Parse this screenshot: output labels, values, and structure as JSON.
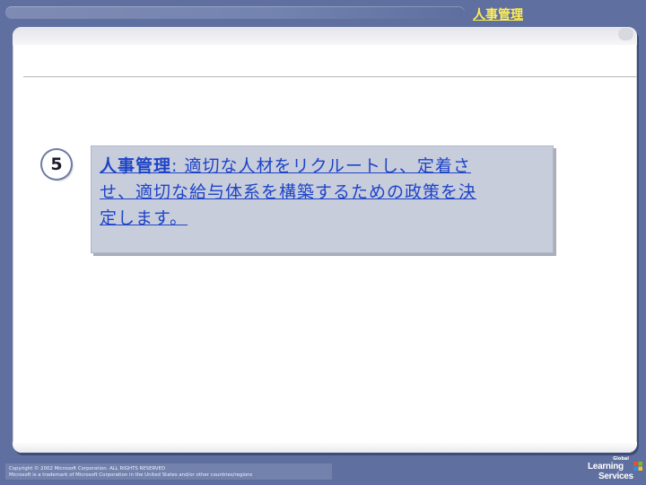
{
  "header": {
    "topic_link": "人事管理"
  },
  "slide": {
    "number": "5",
    "term": "人事管理",
    "separator": ":",
    "definition_line1": " 適切な人材をリクルートし、定着さ",
    "definition_line2": "せ、適切な給与体系を構築するための政策を決",
    "definition_line3": "定します。"
  },
  "footer": {
    "copyright_line1": "Copyright © 2002 Microsoft Corporation. ALL RIGHTS RESERVED",
    "copyright_line2": "Microsoft is a trademark of Microsoft Corporation in the United States and/or other countries/regions",
    "logo_top": "Global",
    "logo_learning": "Learning",
    "logo_services": "Services"
  },
  "colors": {
    "background": "#5f6f9f",
    "link": "#ffee55",
    "body_text": "#1e44c8",
    "textbox": "#c8cddc"
  }
}
